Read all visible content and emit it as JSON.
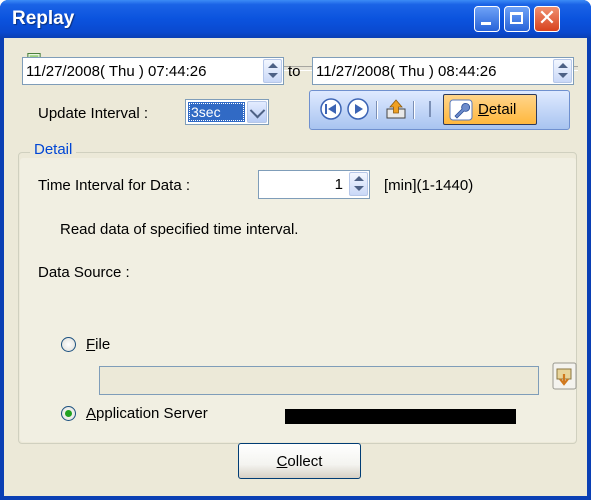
{
  "window": {
    "title": "Replay"
  },
  "time_range": {
    "start": "11/27/2008( Thu ) 07:44:26",
    "to_label": "to",
    "end": "11/27/2008( Thu ) 08:44:26"
  },
  "update_interval": {
    "label": "Update Interval :",
    "value": "3sec"
  },
  "toolbar": {
    "detail_label": "Detail",
    "detail_mnemonic": "D",
    "detail_rest": "etail"
  },
  "detail": {
    "group_title": "Detail",
    "time_interval_label": "Time Interval for Data :",
    "time_interval_value": "1",
    "time_interval_unit": "[min](1-1440)",
    "description": "Read data of specified time interval.",
    "data_source_label": "Data Source :",
    "file_option": {
      "mnemonic": "F",
      "rest": "ile",
      "checked": false
    },
    "file_path": "",
    "app_server_option": {
      "mnemonic": "A",
      "rest": "pplication Server",
      "checked": true
    },
    "collect_button": {
      "mnemonic": "C",
      "rest": "ollect"
    }
  },
  "colors": {
    "titlebar": "#0b53de",
    "accent": "#0046d5",
    "detail_active": "#ffb83d"
  }
}
